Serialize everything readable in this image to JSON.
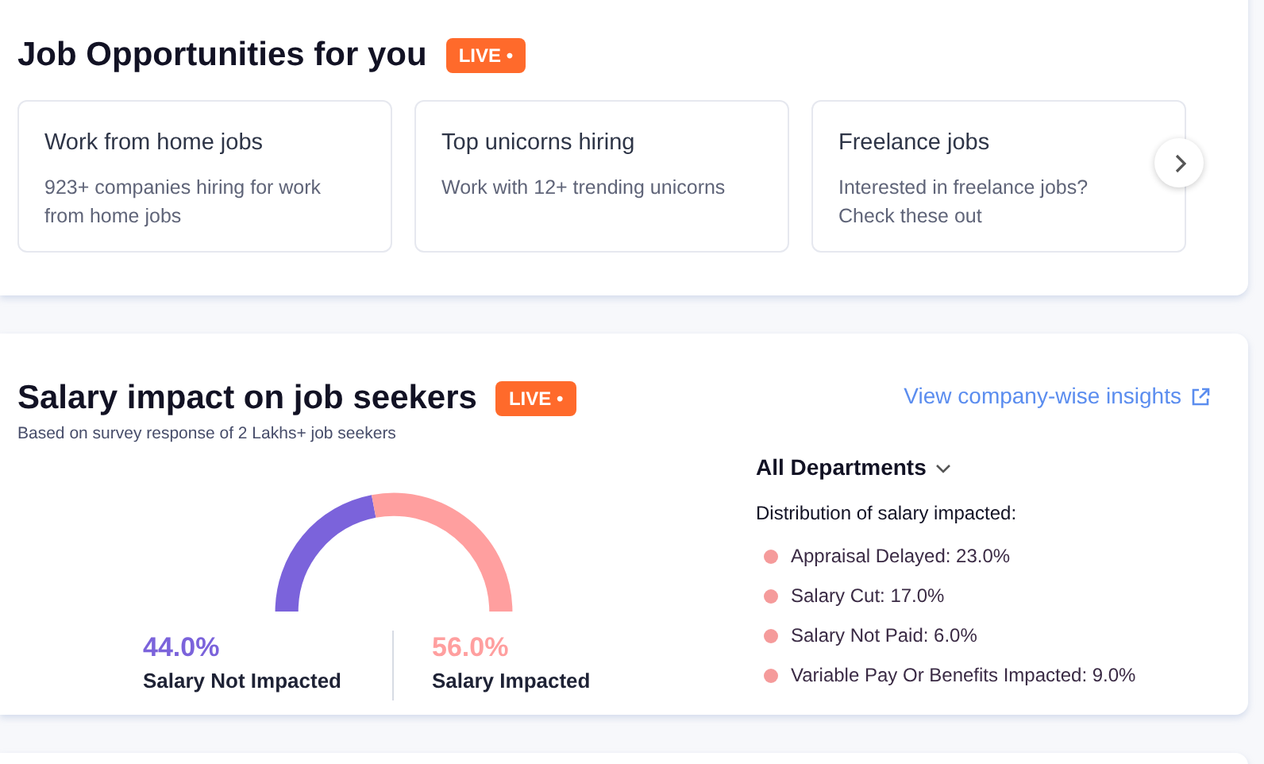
{
  "job_opportunities": {
    "title": "Job Opportunities for you",
    "badge": "LIVE •",
    "cards": [
      {
        "title": "Work from home jobs",
        "description": "923+ companies hiring for work from home jobs"
      },
      {
        "title": "Top unicorns hiring",
        "description": "Work with 12+ trending unicorns"
      },
      {
        "title": "Freelance jobs",
        "description": "Interested in freelance jobs? Check these out"
      }
    ]
  },
  "salary_impact": {
    "title": "Salary impact on job seekers",
    "badge": "LIVE •",
    "subtitle": "Based on survey response of 2 Lakhs+ job seekers",
    "link": "View company-wise insights",
    "stats": [
      {
        "value": "44.0%",
        "label": "Salary Not Impacted",
        "color": "#7b63db"
      },
      {
        "value": "56.0%",
        "label": "Salary Impacted",
        "color": "#ff9f9f"
      }
    ],
    "department_dropdown": "All Departments",
    "distribution_title": "Distribution of salary impacted:",
    "distribution": [
      {
        "label": "Appraisal Delayed: 23.0%"
      },
      {
        "label": "Salary Cut: 17.0%"
      },
      {
        "label": "Salary Not Paid: 6.0%"
      },
      {
        "label": "Variable Pay Or Benefits Impacted: 9.0%"
      }
    ]
  }
}
